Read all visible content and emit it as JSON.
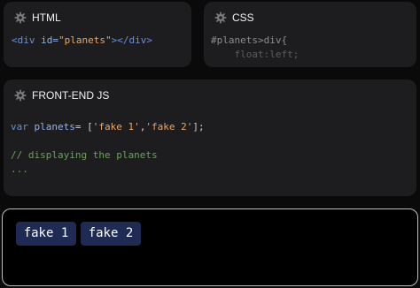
{
  "panels": {
    "html": {
      "title": "HTML",
      "code": {
        "open_tag": "<div",
        "attr_name": " id=",
        "attr_value": "\"planets\"",
        "close": "></div>"
      }
    },
    "css": {
      "title": "CSS",
      "code": {
        "line1": "#planets>div{",
        "prop": "    float",
        "colon": ":",
        "value": "left;"
      }
    },
    "js": {
      "title": "FRONT-END JS",
      "code": {
        "keyword": "var",
        "var_name": " planets",
        "eq": "= [",
        "str1": "'fake 1'",
        "comma": ",",
        "str2": "'fake 2'",
        "end": "];",
        "comment": "// displaying the planets",
        "dots": "..."
      }
    }
  },
  "output": {
    "planets": [
      "fake 1",
      "fake 2"
    ]
  },
  "colors": {
    "background": "#0a0a0b",
    "panel": "#1d1d1f",
    "planet_bg": "#1f2a55",
    "output_border": "#bdbdbd"
  },
  "icons": {
    "panel_header": "gear-icon"
  }
}
